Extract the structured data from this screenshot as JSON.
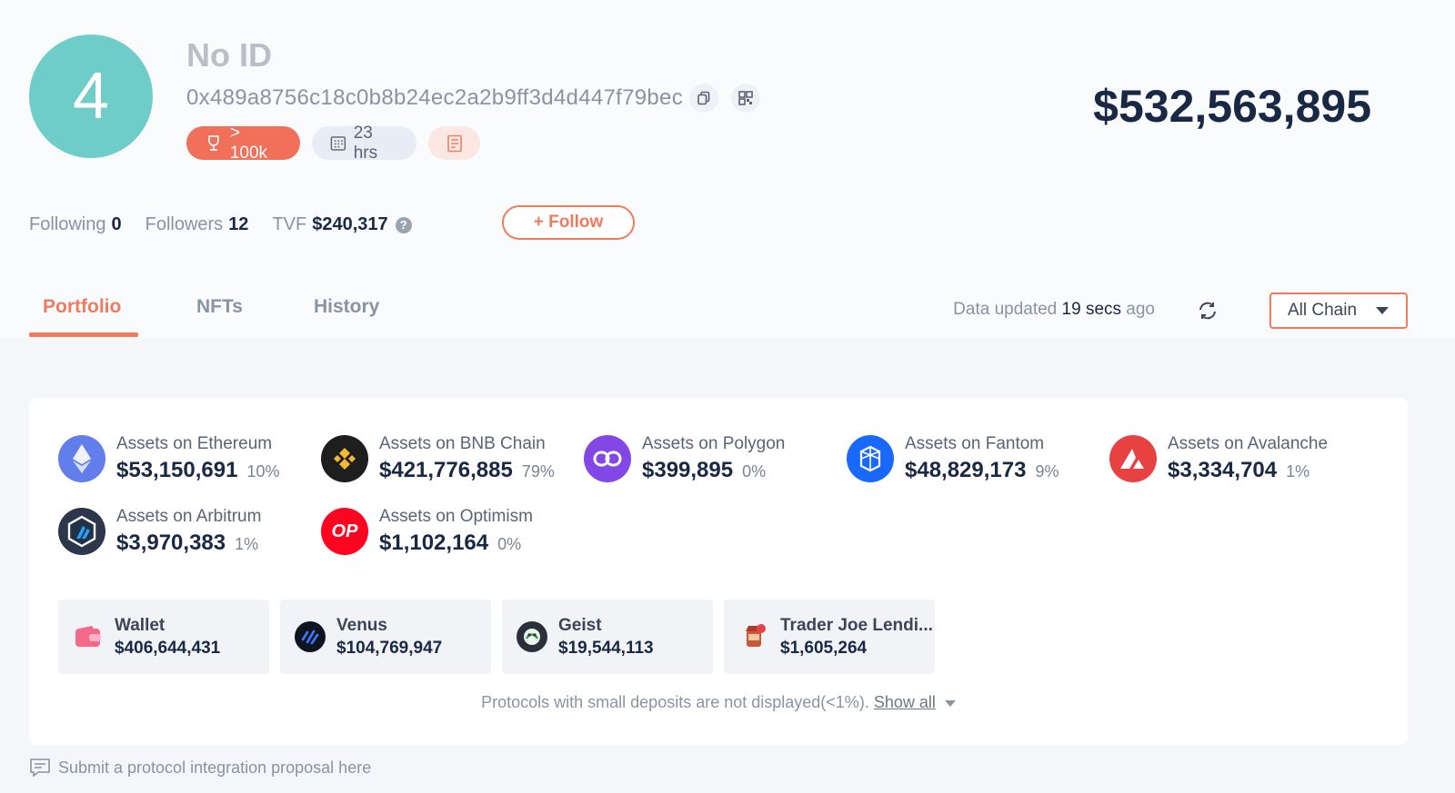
{
  "profile": {
    "avatar_text": "4",
    "name": "No ID",
    "address": "0x489a8756c18c0b8b24ec2a2b9ff3d4d447f79bec",
    "rank_badge": "> 100k",
    "time_badge": "23 hrs",
    "total_value": "$532,563,895"
  },
  "stats": {
    "following_label": "Following",
    "following_value": "0",
    "followers_label": "Followers",
    "followers_value": "12",
    "tvf_label": "TVF",
    "tvf_value": "$240,317",
    "follow_button": "+ Follow"
  },
  "tabs": [
    {
      "label": "Portfolio",
      "active": true
    },
    {
      "label": "NFTs",
      "active": false
    },
    {
      "label": "History",
      "active": false
    }
  ],
  "data_updated": {
    "prefix": "Data updated",
    "time": "19 secs",
    "suffix": "ago"
  },
  "chain_select": {
    "value": "All Chain"
  },
  "chains": [
    {
      "label": "Assets on Ethereum",
      "value": "$53,150,691",
      "pct": "10%",
      "color": "#627eea",
      "icon": "ethereum-icon"
    },
    {
      "label": "Assets on BNB Chain",
      "value": "$421,776,885",
      "pct": "79%",
      "color": "#1e1e1e",
      "icon": "bnb-icon"
    },
    {
      "label": "Assets on Polygon",
      "value": "$399,895",
      "pct": "0%",
      "color": "#8247e5",
      "icon": "polygon-icon"
    },
    {
      "label": "Assets on Fantom",
      "value": "$48,829,173",
      "pct": "9%",
      "color": "#1969ff",
      "icon": "fantom-icon"
    },
    {
      "label": "Assets on Avalanche",
      "value": "$3,334,704",
      "pct": "1%",
      "color": "#e84142",
      "icon": "avalanche-icon"
    },
    {
      "label": "Assets on Arbitrum",
      "value": "$3,970,383",
      "pct": "1%",
      "color": "#2d374b",
      "icon": "arbitrum-icon"
    },
    {
      "label": "Assets on Optimism",
      "value": "$1,102,164",
      "pct": "0%",
      "color": "#ff0420",
      "icon": "optimism-icon",
      "icon_text": "OP"
    }
  ],
  "protocols": [
    {
      "name": "Wallet",
      "value": "$406,644,431",
      "icon": "wallet-icon"
    },
    {
      "name": "Venus",
      "value": "$104,769,947",
      "icon": "venus-icon"
    },
    {
      "name": "Geist",
      "value": "$19,544,113",
      "icon": "geist-icon"
    },
    {
      "name": "Trader Joe Lendi...",
      "value": "$1,605,264",
      "icon": "trader-joe-icon"
    }
  ],
  "small_note": {
    "text": "Protocols with small deposits are not displayed(<1%).",
    "link": "Show all"
  },
  "proposal_text": "Submit a protocol integration proposal here"
}
